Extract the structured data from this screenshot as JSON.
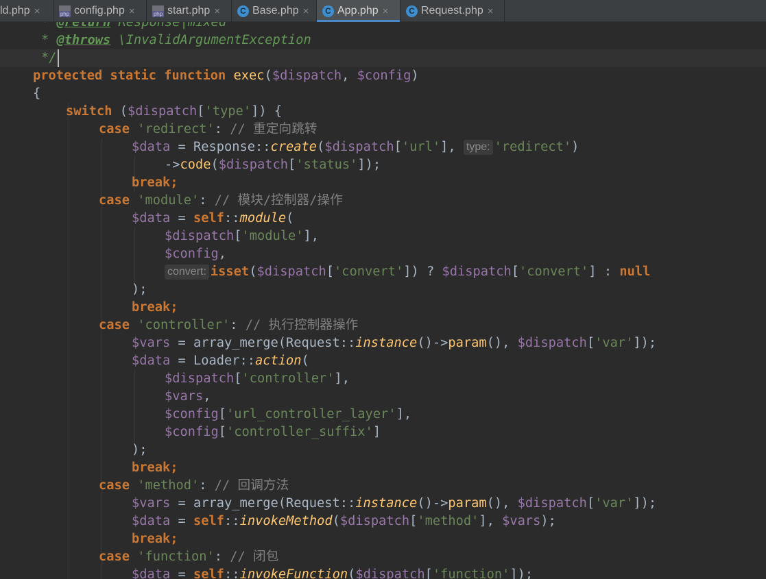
{
  "tabs": [
    {
      "label": "ld.php",
      "icon": "php-file-icon"
    },
    {
      "label": "config.php",
      "icon": "php-file-icon"
    },
    {
      "label": "start.php",
      "icon": "php-file-icon"
    },
    {
      "label": "Base.php",
      "icon": "class-icon"
    },
    {
      "label": "App.php",
      "icon": "class-icon",
      "active": true
    },
    {
      "label": "Request.php",
      "icon": "class-icon"
    }
  ],
  "tab_close": "×",
  "class_letter": "C",
  "accent_color": "#4a88c7",
  "code": {
    "l0": {
      "a": "* ",
      "b": "@return",
      "c": " Response|mixed"
    },
    "l1": {
      "a": "* ",
      "b": "@throws",
      "c": " \\InvalidArgumentException"
    },
    "l2": {
      "a": "*/"
    },
    "l3": {
      "a": "protected static function ",
      "b": "exec",
      "c": "(",
      "d": "$dispatch",
      ",": ", ",
      "e": "$config",
      "f": ")"
    },
    "l4": {
      "a": "{"
    },
    "l5": {
      "a": "switch",
      " ": " (",
      "b": "$dispatch",
      "c": "[",
      "d": "'type'",
      "e": "]) {"
    },
    "l6": {
      "a": "case ",
      "b": "'redirect'",
      "c": ": ",
      "d": "// 重定向跳转"
    },
    "l7": {
      "a": "$data",
      " ": " = Response::",
      "b": "create",
      "c": "(",
      "d": "$dispatch",
      "e": "[",
      "f": "'url'",
      "g": "], ",
      "hint": "type:",
      "h": "'redirect'",
      "i": ")"
    },
    "l8": {
      "a": "->",
      "b": "code",
      "c": "(",
      "d": "$dispatch",
      "e": "[",
      "f": "'status'",
      "g": "]);"
    },
    "l9": {
      "a": "break",
      ";": ";"
    },
    "l10": {
      "a": "case ",
      "b": "'module'",
      "c": ": ",
      "d": "// 模块/控制器/操作"
    },
    "l11": {
      "a": "$data",
      " ": " = ",
      "b": "self",
      "c": "::",
      "d": "module",
      "e": "("
    },
    "l12": {
      "a": "$dispatch",
      "b": "[",
      "c": "'module'",
      "d": "],"
    },
    "l13": {
      "a": "$config",
      "b": ","
    },
    "l14": {
      "hint": "convert:",
      "a": "isset",
      "b": "(",
      "c": "$dispatch",
      "d": "[",
      "e": "'convert'",
      "f": "]) ? ",
      "g": "$dispatch",
      "h": "[",
      "i": "'convert'",
      "j": "] : ",
      "k": "null"
    },
    "l15": {
      "a": ");"
    },
    "l16": {
      "a": "break",
      ";": ";"
    },
    "l17": {
      "a": "case ",
      "b": "'controller'",
      "c": ": ",
      "d": "// 执行控制器操作"
    },
    "l18": {
      "a": "$vars",
      " ": " = array_merge(Request::",
      "b": "instance",
      "c": "()->",
      "d": "param",
      "e": "(), ",
      "f": "$dispatch",
      "g": "[",
      "h": "'var'",
      "i": "]);"
    },
    "l19": {
      "a": "$data",
      " ": " = Loader::",
      "b": "action",
      "c": "("
    },
    "l20": {
      "a": "$dispatch",
      "b": "[",
      "c": "'controller'",
      "d": "],"
    },
    "l21": {
      "a": "$vars",
      "b": ","
    },
    "l22": {
      "a": "$config",
      "b": "[",
      "c": "'url_controller_layer'",
      "d": "],"
    },
    "l23": {
      "a": "$config",
      "b": "[",
      "c": "'controller_suffix'",
      "d": "]"
    },
    "l24": {
      "a": ");"
    },
    "l25": {
      "a": "break",
      ";": ";"
    },
    "l26": {
      "a": "case ",
      "b": "'method'",
      "c": ": ",
      "d": "// 回调方法"
    },
    "l27": {
      "a": "$vars",
      " ": " = array_merge(Request::",
      "b": "instance",
      "c": "()->",
      "d": "param",
      "e": "(), ",
      "f": "$dispatch",
      "g": "[",
      "h": "'var'",
      "i": "]);"
    },
    "l28": {
      "a": "$data",
      " ": " = ",
      "b": "self",
      "c": "::",
      "d": "invokeMethod",
      "e": "(",
      "f": "$dispatch",
      "g": "[",
      "h": "'method'",
      "i": "], ",
      "j": "$vars",
      "k": ");"
    },
    "l29": {
      "a": "break",
      ";": ";"
    },
    "l30": {
      "a": "case ",
      "b": "'function'",
      "c": ": ",
      "d": "// 闭包"
    },
    "l31": {
      "a": "$data",
      " ": " = ",
      "b": "self",
      "c": "::",
      "d": "invokeFunction",
      "e": "(",
      "f": "$dispatch",
      "g": "[",
      "h": "'function'",
      "i": "]);"
    }
  }
}
